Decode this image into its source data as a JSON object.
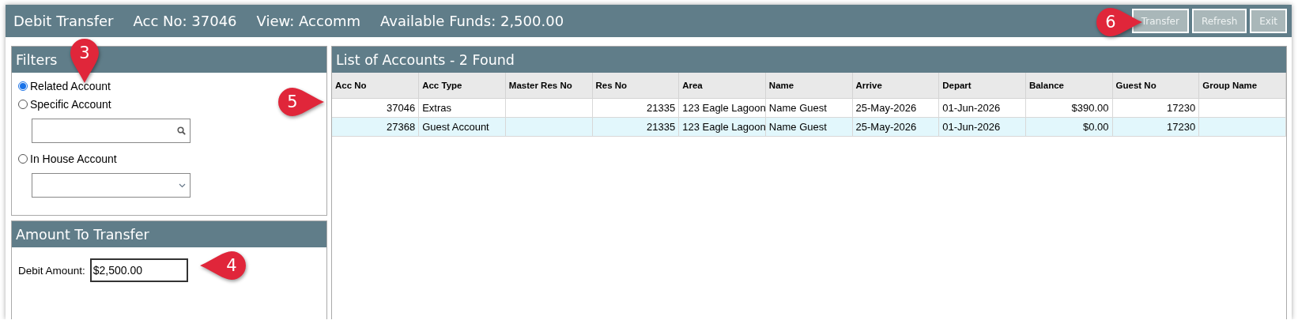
{
  "window": {
    "title": "Debit Transfer",
    "acc_no": "Acc No: 37046",
    "view": "View: Accomm",
    "available_funds": "Available Funds: 2,500.00"
  },
  "toolbar": {
    "buttons": [
      {
        "label": "Transfer"
      },
      {
        "label": "Refresh"
      },
      {
        "label": "Exit"
      }
    ]
  },
  "filters": {
    "title": "Filters",
    "options": [
      {
        "label": "Related Account",
        "selected": true,
        "kind": "plain"
      },
      {
        "label": "Specific Account",
        "selected": false,
        "kind": "search"
      },
      {
        "label": "In House Account",
        "selected": false,
        "kind": "dropdown"
      }
    ]
  },
  "amount": {
    "title": "Amount To Transfer",
    "label": "Debit Amount:",
    "value": "$2,500.00"
  },
  "accounts": {
    "title": "List of Accounts - 2 Found",
    "columns": [
      "Acc No",
      "Acc Type",
      "Master Res No",
      "Res No",
      "Area",
      "Name",
      "Arrive",
      "Depart",
      "Balance",
      "Guest No",
      "Group Name"
    ],
    "rows": [
      {
        "selected": false,
        "cells": [
          "37046",
          "Extras",
          "",
          "21335",
          "123 Eagle Lagoon",
          "Name Guest",
          "25-May-2026",
          "01-Jun-2026",
          "$390.00",
          "17230",
          ""
        ]
      },
      {
        "selected": true,
        "cells": [
          "27368",
          "Guest Account",
          "",
          "21335",
          "123 Eagle Lagoon",
          "Name Guest",
          "25-May-2026",
          "01-Jun-2026",
          "$0.00",
          "17230",
          ""
        ]
      }
    ]
  },
  "callouts": [
    {
      "label": "3"
    },
    {
      "label": "4"
    },
    {
      "label": "5"
    },
    {
      "label": "6"
    }
  ]
}
